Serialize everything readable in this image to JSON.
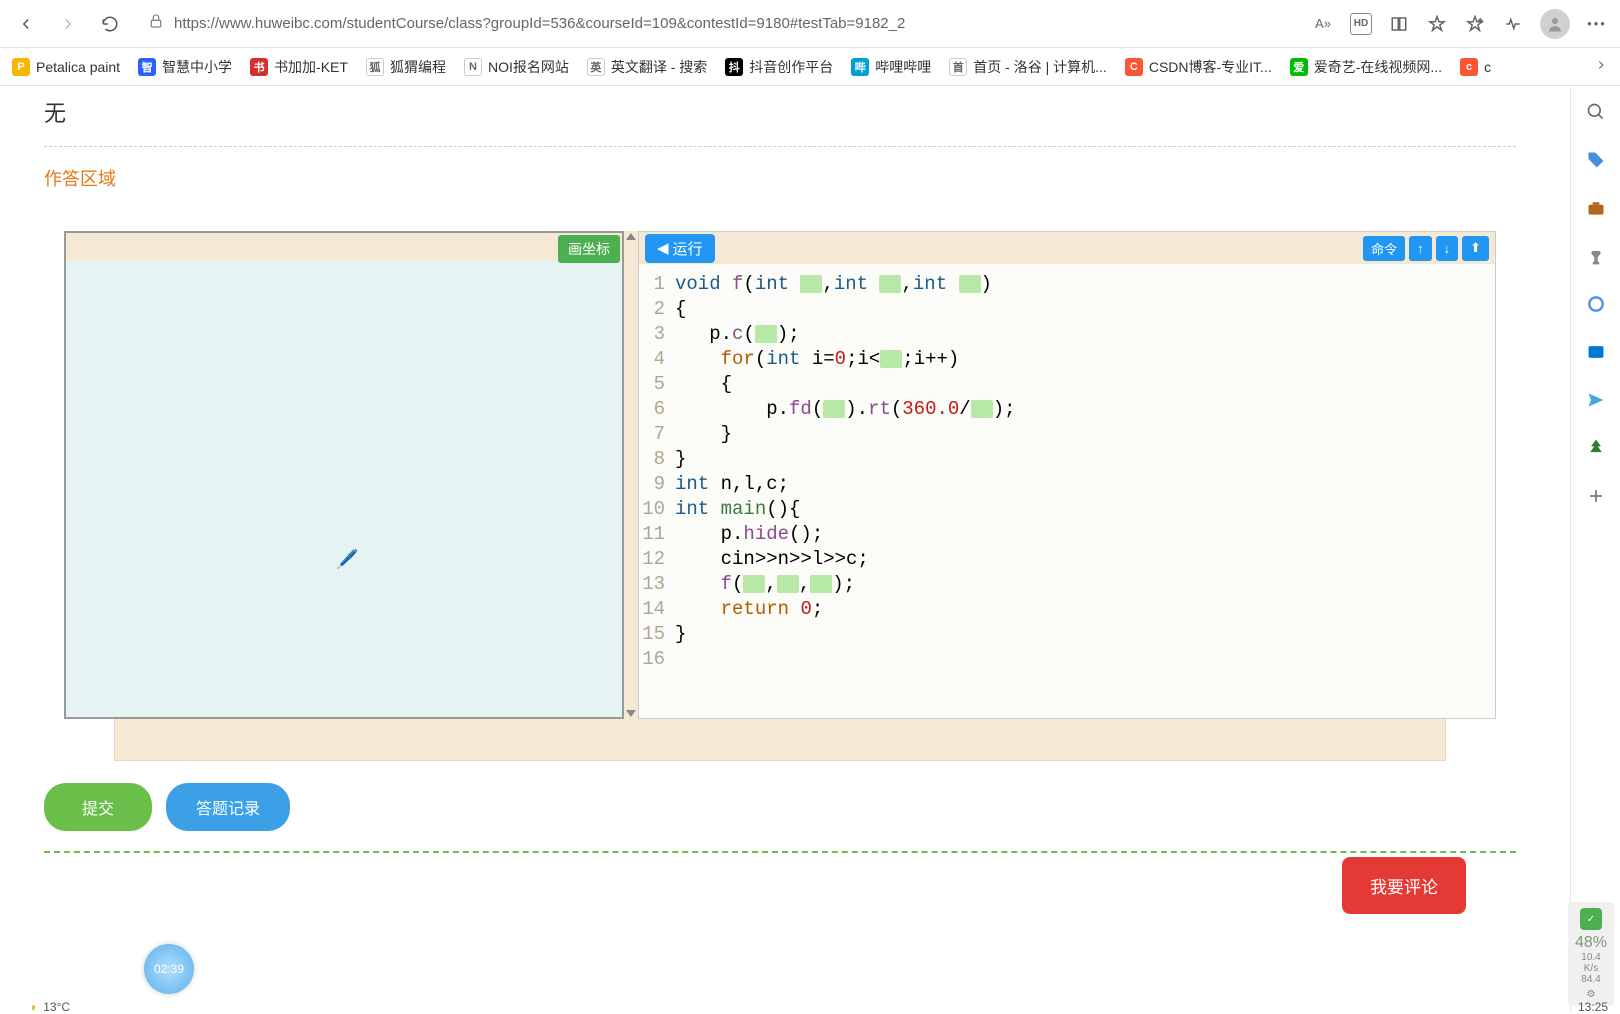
{
  "browser": {
    "url": "https://www.huweibc.com/studentCourse/class?groupId=536&courseId=109&contestId=9180#testTab=9182_2",
    "read_aloud": "A»",
    "hd": "HD"
  },
  "bookmarks": [
    {
      "label": "Petalica paint",
      "color": "#f7b500"
    },
    {
      "label": "智慧中小学",
      "color": "#2962ff"
    },
    {
      "label": "书加加-KET",
      "color": "#d32f2f"
    },
    {
      "label": "狐猬编程",
      "color": "#ffffff"
    },
    {
      "label": "NOI报名网站",
      "color": "#ffffff"
    },
    {
      "label": "英文翻译 - 搜索",
      "color": "#ffffff"
    },
    {
      "label": "抖音创作平台",
      "color": "#000000"
    },
    {
      "label": "哔哩哔哩",
      "color": "#00a1d6"
    },
    {
      "label": "首页 - 洛谷 | 计算机...",
      "color": "#ffffff"
    },
    {
      "label": "CSDN博客-专业IT...",
      "color": "#fc5531"
    },
    {
      "label": "爱奇艺-在线视频网...",
      "color": "#00be06"
    },
    {
      "label": "c",
      "color": "#fc5531"
    }
  ],
  "page": {
    "none": "无",
    "answer_area": "作答区域",
    "draw_axis": "画坐标",
    "run": "运行",
    "cmd": "命令",
    "submit": "提交",
    "history": "答题记录",
    "comment": "我要评论",
    "timer": "02:39"
  },
  "code_lines": [
    {
      "n": 1,
      "tokens": [
        {
          "t": "void",
          "c": "kw-type"
        },
        {
          "t": " "
        },
        {
          "t": "f",
          "c": "fn"
        },
        {
          "t": "("
        },
        {
          "t": "int",
          "c": "kw-type"
        },
        {
          "t": " "
        },
        {
          "blank": true
        },
        {
          "t": ","
        },
        {
          "t": "int",
          "c": "kw-type"
        },
        {
          "t": " "
        },
        {
          "blank": true
        },
        {
          "t": ","
        },
        {
          "t": "int",
          "c": "kw-type"
        },
        {
          "t": " "
        },
        {
          "blank": true
        },
        {
          "t": ")"
        }
      ]
    },
    {
      "n": 2,
      "tokens": [
        {
          "t": "{"
        }
      ]
    },
    {
      "n": 3,
      "tokens": [
        {
          "t": "   p."
        },
        {
          "t": "c",
          "c": "fn"
        },
        {
          "t": "("
        },
        {
          "blank": true
        },
        {
          "t": ");"
        }
      ]
    },
    {
      "n": 4,
      "tokens": [
        {
          "t": "    "
        },
        {
          "t": "for",
          "c": "kw-ctrl"
        },
        {
          "t": "("
        },
        {
          "t": "int",
          "c": "kw-type"
        },
        {
          "t": " i="
        },
        {
          "t": "0",
          "c": "num"
        },
        {
          "t": ";i<"
        },
        {
          "blank": true
        },
        {
          "t": ";i++)"
        }
      ]
    },
    {
      "n": 5,
      "tokens": [
        {
          "t": "    {"
        }
      ]
    },
    {
      "n": 6,
      "tokens": [
        {
          "t": "        p."
        },
        {
          "t": "fd",
          "c": "fn"
        },
        {
          "t": "("
        },
        {
          "blank": true
        },
        {
          "t": ")."
        },
        {
          "t": "rt",
          "c": "fn"
        },
        {
          "t": "("
        },
        {
          "t": "360.0",
          "c": "num"
        },
        {
          "t": "/"
        },
        {
          "blank": true
        },
        {
          "t": ");"
        }
      ]
    },
    {
      "n": 7,
      "tokens": [
        {
          "t": "    }"
        }
      ]
    },
    {
      "n": 8,
      "tokens": [
        {
          "t": "}"
        }
      ]
    },
    {
      "n": 9,
      "tokens": [
        {
          "t": "int",
          "c": "kw-type"
        },
        {
          "t": " n,l,c;"
        }
      ]
    },
    {
      "n": 10,
      "tokens": [
        {
          "t": "int",
          "c": "kw-type"
        },
        {
          "t": " "
        },
        {
          "t": "main",
          "c": "ident"
        },
        {
          "t": "(){"
        }
      ]
    },
    {
      "n": 11,
      "tokens": [
        {
          "t": "    p."
        },
        {
          "t": "hide",
          "c": "fn"
        },
        {
          "t": "();"
        }
      ]
    },
    {
      "n": 12,
      "tokens": [
        {
          "t": "    cin>>n>>l>>c;"
        }
      ]
    },
    {
      "n": 13,
      "tokens": [
        {
          "t": "    "
        },
        {
          "t": "f",
          "c": "fn"
        },
        {
          "t": "("
        },
        {
          "blank": true
        },
        {
          "t": ","
        },
        {
          "blank": true
        },
        {
          "t": ","
        },
        {
          "blank": true
        },
        {
          "t": ");"
        }
      ]
    },
    {
      "n": 14,
      "tokens": [
        {
          "t": "    "
        },
        {
          "t": "return",
          "c": "kw-ctrl"
        },
        {
          "t": " "
        },
        {
          "t": "0",
          "c": "num"
        },
        {
          "t": ";"
        }
      ]
    },
    {
      "n": 15,
      "tokens": [
        {
          "t": "}"
        }
      ]
    },
    {
      "n": 16,
      "tokens": [
        {
          "t": ""
        }
      ]
    }
  ],
  "perf": {
    "pct": "48%",
    "net": "10.4",
    "net_unit": "K/s",
    "mem": "84.4"
  },
  "taskbar": {
    "temp": "13°C",
    "time": "13:25"
  }
}
